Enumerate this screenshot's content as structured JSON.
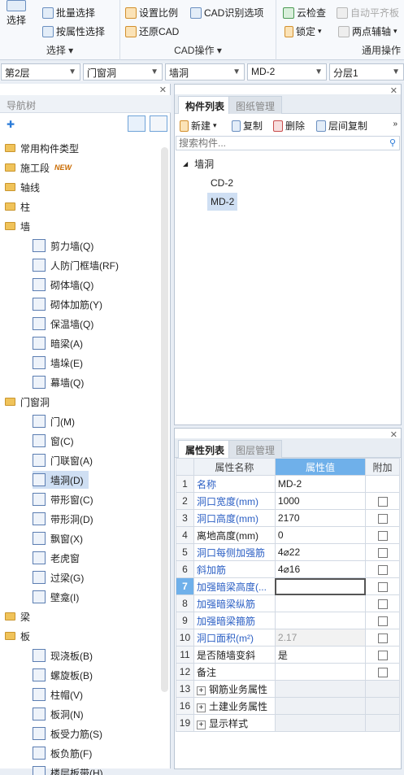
{
  "ribbon": {
    "select_group": {
      "label": "选择",
      "select_btn": "选择",
      "batch_select": "批量选择",
      "attr_select": "按属性选择"
    },
    "cad_group": {
      "label": "CAD操作",
      "set_scale": "设置比例",
      "cad_recognize": "CAD识别选项",
      "restore_cad": "还原CAD"
    },
    "general_group": {
      "label": "通用操作",
      "cloud_check": "云检查",
      "auto_align": "自动平齐板",
      "lock": "锁定",
      "two_point": "两点辅轴"
    }
  },
  "selectors": {
    "floor": "第2层",
    "category": "门窗洞",
    "type": "墙洞",
    "component": "MD-2",
    "layer": "分层1"
  },
  "nav": {
    "title": "导航树",
    "items": [
      {
        "label": "常用构件类型",
        "kind": "folder"
      },
      {
        "label": "施工段",
        "kind": "folder",
        "badge": "NEW"
      },
      {
        "label": "轴线",
        "kind": "folder"
      },
      {
        "label": "柱",
        "kind": "folder"
      },
      {
        "label": "墙",
        "kind": "folder"
      },
      {
        "label": "剪力墙(Q)",
        "kind": "child"
      },
      {
        "label": "人防门框墙(RF)",
        "kind": "child"
      },
      {
        "label": "砌体墙(Q)",
        "kind": "child"
      },
      {
        "label": "砌体加筋(Y)",
        "kind": "child"
      },
      {
        "label": "保温墙(Q)",
        "kind": "child"
      },
      {
        "label": "暗梁(A)",
        "kind": "child"
      },
      {
        "label": "墙垛(E)",
        "kind": "child"
      },
      {
        "label": "幕墙(Q)",
        "kind": "child"
      },
      {
        "label": "门窗洞",
        "kind": "folder"
      },
      {
        "label": "门(M)",
        "kind": "child"
      },
      {
        "label": "窗(C)",
        "kind": "child"
      },
      {
        "label": "门联窗(A)",
        "kind": "child"
      },
      {
        "label": "墙洞(D)",
        "kind": "child",
        "selected": true
      },
      {
        "label": "带形窗(C)",
        "kind": "child"
      },
      {
        "label": "带形洞(D)",
        "kind": "child"
      },
      {
        "label": "飘窗(X)",
        "kind": "child"
      },
      {
        "label": "老虎窗",
        "kind": "child"
      },
      {
        "label": "过梁(G)",
        "kind": "child"
      },
      {
        "label": "壁龛(I)",
        "kind": "child"
      },
      {
        "label": "梁",
        "kind": "folder"
      },
      {
        "label": "板",
        "kind": "folder"
      },
      {
        "label": "现浇板(B)",
        "kind": "child"
      },
      {
        "label": "螺旋板(B)",
        "kind": "child"
      },
      {
        "label": "柱帽(V)",
        "kind": "child"
      },
      {
        "label": "板洞(N)",
        "kind": "child"
      },
      {
        "label": "板受力筋(S)",
        "kind": "child"
      },
      {
        "label": "板负筋(F)",
        "kind": "child"
      },
      {
        "label": "楼层板带(H)",
        "kind": "child"
      }
    ]
  },
  "components": {
    "tabs": [
      "构件列表",
      "图纸管理"
    ],
    "tools": {
      "new": "新建",
      "copy": "复制",
      "delete": "删除",
      "floor_copy": "层间复制"
    },
    "search_placeholder": "搜索构件...",
    "tree": {
      "root": "墙洞",
      "items": [
        "CD-2",
        "MD-2"
      ]
    }
  },
  "properties": {
    "tabs": [
      "属性列表",
      "图层管理"
    ],
    "headers": {
      "name": "属性名称",
      "value": "属性值",
      "add": "附加"
    },
    "rows": [
      {
        "n": "1",
        "name": "名称",
        "value": "MD-2",
        "blue": true,
        "check": false
      },
      {
        "n": "2",
        "name": "洞口宽度(mm)",
        "value": "1000",
        "blue": true,
        "check": true
      },
      {
        "n": "3",
        "name": "洞口高度(mm)",
        "value": "2170",
        "blue": true,
        "check": true
      },
      {
        "n": "4",
        "name": "离地高度(mm)",
        "value": "0",
        "blue": false,
        "check": true
      },
      {
        "n": "5",
        "name": "洞口每侧加强筋",
        "value": "4⌀22",
        "blue": true,
        "check": true
      },
      {
        "n": "6",
        "name": "斜加筋",
        "value": "4⌀16",
        "blue": true,
        "check": true
      },
      {
        "n": "7",
        "name": "加强暗梁高度(...",
        "value": "",
        "blue": true,
        "check": true,
        "editing": true
      },
      {
        "n": "8",
        "name": "加强暗梁纵筋",
        "value": "",
        "blue": true,
        "check": true
      },
      {
        "n": "9",
        "name": "加强暗梁箍筋",
        "value": "",
        "blue": true,
        "check": true
      },
      {
        "n": "10",
        "name": "洞口面积(m²)",
        "value": "2.17",
        "blue": true,
        "check": true,
        "gray": true
      },
      {
        "n": "11",
        "name": "是否随墙变斜",
        "value": "是",
        "blue": false,
        "check": true
      },
      {
        "n": "12",
        "name": "备注",
        "value": "",
        "blue": false,
        "check": true
      }
    ],
    "groups": [
      {
        "n": "13",
        "label": "钢筋业务属性"
      },
      {
        "n": "16",
        "label": "土建业务属性"
      },
      {
        "n": "19",
        "label": "显示样式"
      }
    ]
  },
  "colors": {
    "accent": "#6fb0ea",
    "link_blue": "#2b5fc4",
    "selected": "#cfdff3"
  }
}
